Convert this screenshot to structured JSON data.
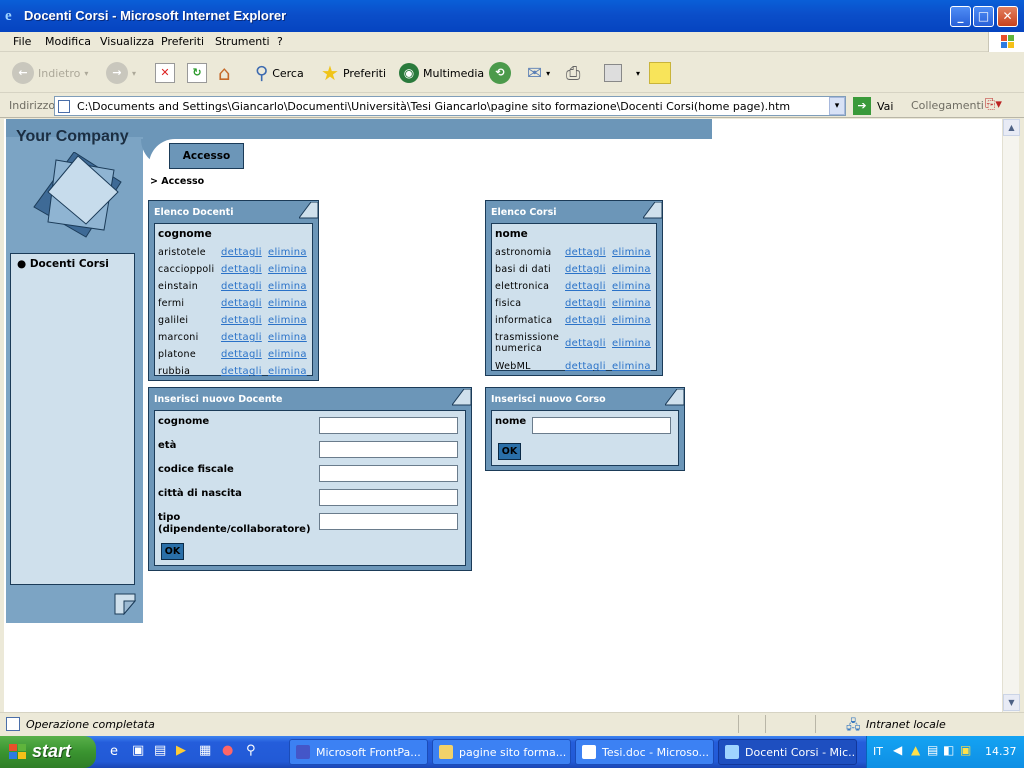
{
  "window": {
    "title": "Docenti Corsi - Microsoft Internet Explorer"
  },
  "menu": [
    "File",
    "Modifica",
    "Visualizza",
    "Preferiti",
    "Strumenti",
    "?"
  ],
  "toolbar": {
    "back": "Indietro",
    "search": "Cerca",
    "favorites": "Preferiti",
    "media": "Multimedia"
  },
  "address": {
    "label": "Indirizzo",
    "url": "C:\\Documents and Settings\\Giancarlo\\Documenti\\Università\\Tesi Giancarlo\\pagine sito formazione\\Docenti Corsi(home page).htm",
    "go": "Vai",
    "links": "Collegamenti"
  },
  "page": {
    "logo": "Your Company",
    "tab": "Accesso",
    "breadcrumb": "> Accesso",
    "nav": {
      "item": "Docenti Corsi"
    },
    "docenti": {
      "title": "Elenco Docenti",
      "header": "cognome",
      "rows": [
        "aristotele",
        "caccioppoli",
        "einstain",
        "fermi",
        "galilei",
        "marconi",
        "platone",
        "rubbia"
      ],
      "details": "dettagli",
      "delete": "elimina"
    },
    "corsi": {
      "title": "Elenco Corsi",
      "header": "nome",
      "rows": [
        "astronomia",
        "basi di dati",
        "elettronica",
        "fisica",
        "informatica",
        "trasmissione numerica",
        "WebML"
      ],
      "details": "dettagli",
      "delete": "elimina"
    },
    "newDocente": {
      "title": "Inserisci nuovo Docente",
      "fields": [
        "cognome",
        "età",
        "codice fiscale",
        "città di nascita",
        "tipo (dipendente/collaboratore)"
      ],
      "ok": "OK"
    },
    "newCorso": {
      "title": "Inserisci nuovo Corso",
      "field": "nome",
      "ok": "OK"
    }
  },
  "status": {
    "text": "Operazione completata",
    "zone": "Intranet locale"
  },
  "taskbar": {
    "start": "start",
    "tasks": [
      "Microsoft FrontPa...",
      "pagine sito forma...",
      "Tesi.doc - Microso...",
      "Docenti Corsi - Mic..."
    ],
    "lang": "IT",
    "clock": "14.37"
  }
}
